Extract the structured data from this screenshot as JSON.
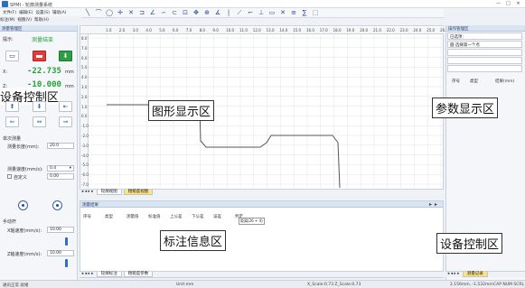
{
  "title": "SPMI - 轮廓测量系统",
  "menu": [
    "文件(F)",
    "编辑(E)",
    "设置(S)",
    "辅助(A)",
    "标注(M)",
    "视图(V)",
    "帮助(H)"
  ],
  "window_buttons": [
    "—",
    "□",
    "✕"
  ],
  "toolbar_icons": [
    {
      "name": "line-icon",
      "glyph": "╲"
    },
    {
      "name": "arc-icon",
      "glyph": "⌒"
    },
    {
      "name": "circle-icon",
      "glyph": "◯"
    },
    {
      "name": "point-icon",
      "glyph": "✛"
    },
    {
      "name": "x-cross-icon",
      "glyph": "✕"
    },
    {
      "name": "distance-icon",
      "glyph": "⊐"
    },
    {
      "name": "angle-icon",
      "glyph": "∠"
    },
    {
      "name": "curve-icon",
      "glyph": "∽"
    },
    {
      "name": "arc-measure-icon",
      "glyph": "⊂"
    },
    {
      "name": "fit-icon",
      "glyph": "⊡"
    },
    {
      "name": "move-icon",
      "glyph": "✥"
    },
    {
      "name": "zoom-icon",
      "glyph": "⊕"
    },
    {
      "name": "angle2-icon",
      "glyph": "∡"
    },
    {
      "name": "vertical-line-icon",
      "glyph": "|"
    },
    {
      "name": "diagonal-icon",
      "glyph": "⟋"
    },
    {
      "name": "corner-icon",
      "glyph": "⌐"
    },
    {
      "name": "tangent-icon",
      "glyph": "⊥"
    },
    {
      "name": "rect-icon",
      "glyph": "▭"
    },
    {
      "name": "cross-icon",
      "glyph": "✕"
    },
    {
      "name": "align-icon",
      "glyph": "≡"
    },
    {
      "name": "sum-icon",
      "glyph": "∑"
    },
    {
      "name": "select-icon",
      "glyph": "⬚"
    }
  ],
  "left_panel": {
    "header": "测量管理区",
    "status_label": "提示:",
    "status_value": "测量结束",
    "x_label": "X:",
    "x_value": "-22.735",
    "x_unit": "mm",
    "z_label": "Z:",
    "z_value": "-10.000",
    "z_unit": "mm",
    "overlay": "设备控制区",
    "single_measure": "单次测量",
    "length_label": "测量长度(mm):",
    "length_value": "20.0",
    "speed_label": "测量速度(mm/s):",
    "speed_value": "0.4",
    "custom_label": "自定义",
    "custom_value": "0.00",
    "manual_label": "手动杆",
    "x_speed_label": "X轴速度(mm/s):",
    "x_speed_value": "10.00",
    "z_speed_label": "Z轴速度(mm/s):",
    "z_speed_value": "10.00"
  },
  "graph": {
    "x_ticks": [
      "1.0",
      "2.0",
      "3.0",
      "4.0",
      "5.0",
      "6.0",
      "7.0",
      "8.0",
      "9.0",
      "10.0",
      "11.0",
      "12.0",
      "13.0",
      "14.0",
      "15.0",
      "16.0",
      "17.0",
      "18.0",
      "19.0",
      "20.0",
      "21.0",
      "22.0",
      "23.0",
      "24.0",
      "25.0",
      "26.0"
    ],
    "y_ticks": [
      "8.0",
      "7.0",
      "6.0",
      "5.0",
      "4.0",
      "3.0",
      "2.0",
      "1.0",
      "0.0",
      "-1.0",
      "-2.0",
      "-3.0",
      "-4.0",
      "-5.0",
      "-6.0",
      "-7.0"
    ],
    "overlay": "图形显示区",
    "tabs": [
      "轮廓视图",
      "粗糙度视图"
    ]
  },
  "right_panel": {
    "header": "操作管理区",
    "line1": "已选项:",
    "line2": "圆 选择第一个点",
    "columns": [
      "序号",
      "类型",
      "结果(mm)"
    ],
    "overlay": "参数显示区",
    "overlay2": "设备控制区",
    "tab": "测量记录"
  },
  "bottom_panel": {
    "header": "测量结果",
    "columns": [
      "序号",
      "类型",
      "测量值",
      "标准值",
      "上公差",
      "下公差",
      "误差",
      "判定"
    ],
    "tooltip": "距离(26 + 4)",
    "overlay": "标注信息区",
    "tabs": [
      "轮廓标注",
      "粗糙度参数"
    ]
  },
  "status": {
    "left": "通讯正常 就绪",
    "unit": "Unit:mm",
    "scale": "X_Scale:0.73    Z_Scale:0.73",
    "coords": "2.156mm, -1.532mm",
    "indicator": "CAP NUM SCRL"
  }
}
